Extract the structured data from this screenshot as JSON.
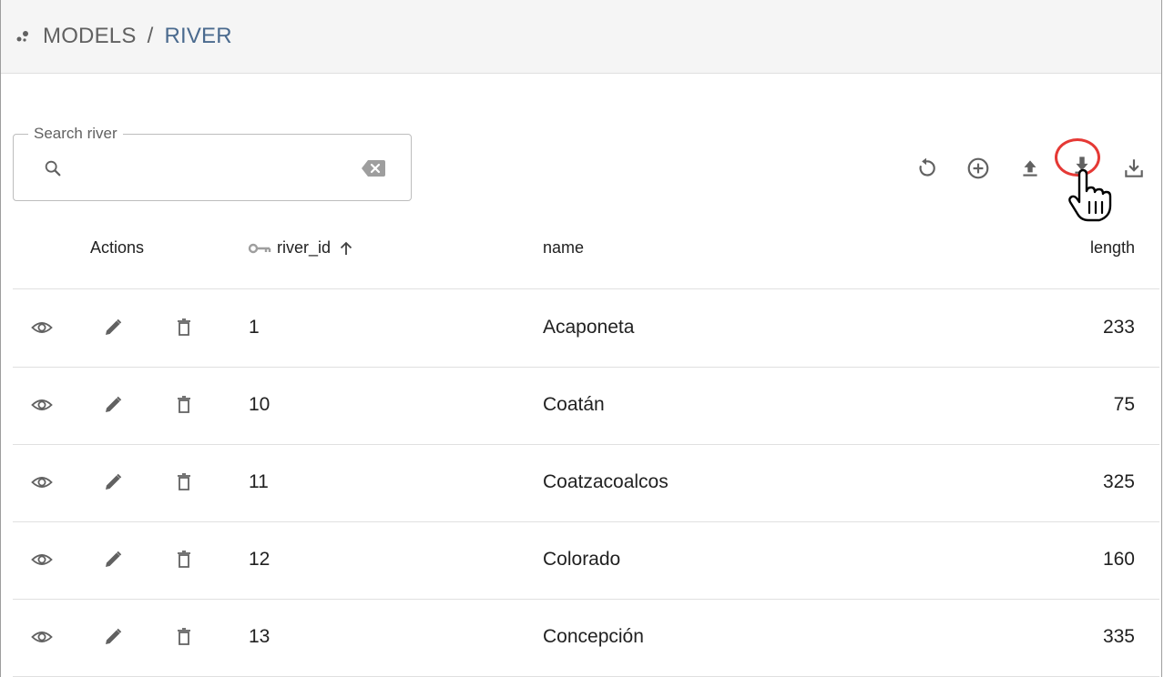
{
  "header": {
    "breadcrumb": [
      "MODELS",
      "/",
      "RIVER"
    ]
  },
  "search": {
    "legend": "Search river",
    "value": "",
    "placeholder": ""
  },
  "toolbar": {
    "icons": [
      "reload-icon",
      "add-circle-icon",
      "upload-icon",
      "download-icon",
      "export-icon"
    ],
    "active": "download-icon"
  },
  "table": {
    "columns": [
      "Actions",
      "river_id",
      "name",
      "length"
    ],
    "sort": {
      "column": "river_id",
      "direction": "asc"
    },
    "rows": [
      {
        "river_id": "1",
        "name": "Acaponeta",
        "length": "233"
      },
      {
        "river_id": "10",
        "name": "Coatán",
        "length": "75"
      },
      {
        "river_id": "11",
        "name": "Coatzacoalcos",
        "length": "325"
      },
      {
        "river_id": "12",
        "name": "Colorado",
        "length": "160"
      },
      {
        "river_id": "13",
        "name": "Concepción",
        "length": "335"
      }
    ]
  },
  "colors": {
    "accent_highlight": "#e53935",
    "breadcrumb_active": "#4a6a8e",
    "icon_gray": "#616161"
  }
}
